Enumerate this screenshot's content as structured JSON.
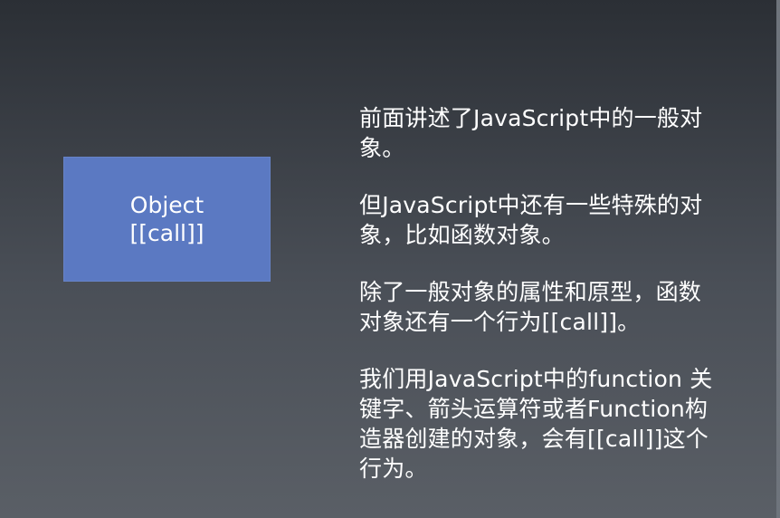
{
  "object_box": {
    "line1": "Object",
    "line2": "[[call]]",
    "color": "#5b79c2"
  },
  "paragraphs": [
    {
      "lines": [
        "前面讲述了JavaScript中的一般对",
        "象。"
      ]
    },
    {
      "lines": [
        "但JavaScript中还有一些特殊的对",
        "象，比如函数对象。"
      ]
    },
    {
      "lines": [
        "除了一般对象的属性和原型，函数",
        "对象还有一个行为[[call]]。"
      ]
    },
    {
      "lines": [
        "我们用JavaScript中的function 关",
        "键字、箭头运算符或者Function构",
        "造器创建的对象，会有[[call]]这个",
        "行为。"
      ]
    }
  ],
  "colors": {
    "background_top": "#2b2f35",
    "background_bottom": "#5a5f66",
    "text": "#ffffff"
  }
}
